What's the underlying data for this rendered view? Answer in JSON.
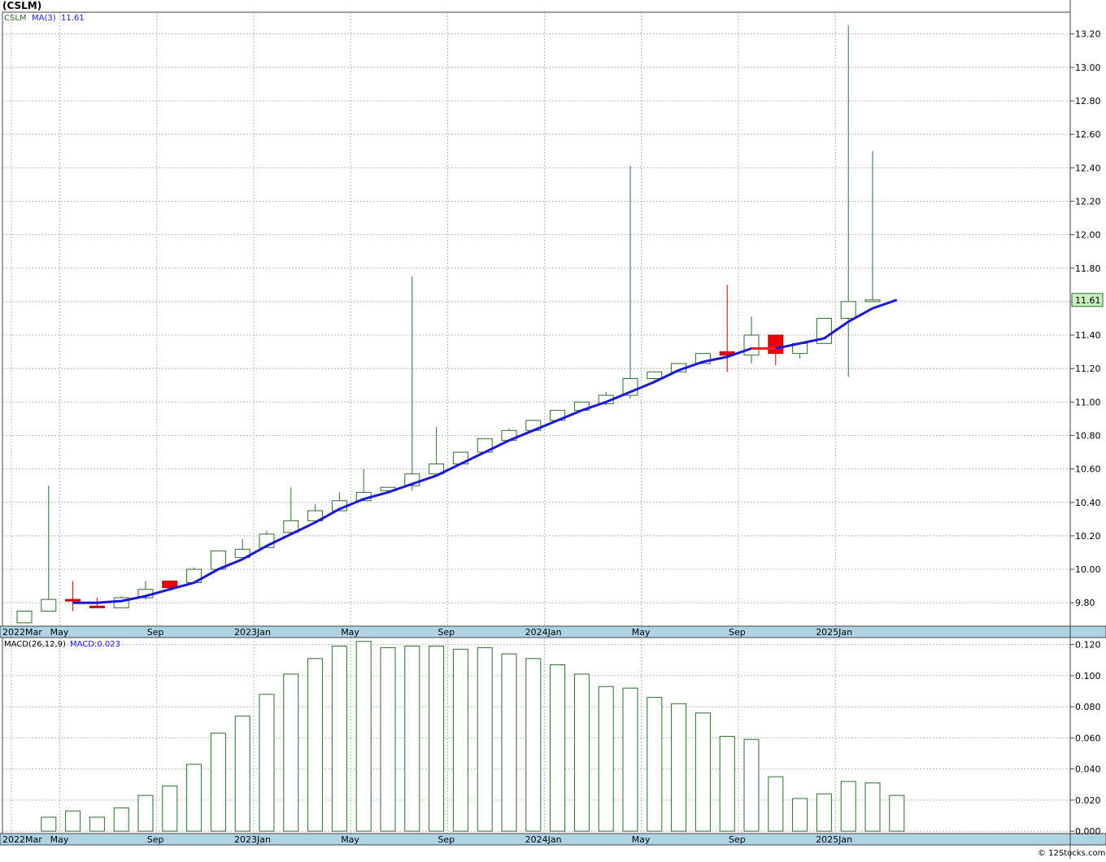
{
  "header": {
    "title": "(CSLM)"
  },
  "colors": {
    "grid": "#b8b8b8",
    "up_stroke": "#2e6b2e",
    "down_fill": "#ee0000",
    "ma_line": "#1818d8",
    "ma_flat": "#ee2222",
    "axis_band": "#aed3e3",
    "macd_bar": "#2e6b2e",
    "last_badge": "#c8f0c0"
  },
  "chart_data": [
    {
      "type": "candlestick",
      "title": "",
      "legend": {
        "symbol": "CSLM",
        "indicator": "MA(3)",
        "indicator_value": "11.61"
      },
      "last_price_label": "11.61",
      "x_tick_labels": [
        "2022Mar",
        "May",
        "Sep",
        "2023Jan",
        "May",
        "Sep",
        "2024Jan",
        "May",
        "Sep",
        "2025Jan"
      ],
      "x_tick_months": [
        0,
        2,
        6,
        10,
        14,
        18,
        22,
        26,
        30,
        34
      ],
      "y_tick_labels": [
        "9.80",
        "10.00",
        "10.20",
        "10.40",
        "10.60",
        "10.80",
        "11.00",
        "11.20",
        "11.40",
        "11.60",
        "11.80",
        "12.00",
        "12.20",
        "12.40",
        "12.60",
        "12.80",
        "13.00",
        "13.20"
      ],
      "ylim": [
        9.66,
        13.33
      ],
      "candles": [
        {
          "m": 0,
          "o": 9.68,
          "h": 9.75,
          "l": 9.68,
          "c": 9.75
        },
        {
          "m": 1,
          "o": 9.75,
          "h": 10.5,
          "l": 9.75,
          "c": 9.82
        },
        {
          "m": 2,
          "o": 9.82,
          "h": 9.93,
          "l": 9.75,
          "c": 9.81
        },
        {
          "m": 3,
          "o": 9.78,
          "h": 9.83,
          "l": 9.77,
          "c": 9.77
        },
        {
          "m": 4,
          "o": 9.77,
          "h": 9.84,
          "l": 9.77,
          "c": 9.83
        },
        {
          "m": 5,
          "o": 9.83,
          "h": 9.93,
          "l": 9.82,
          "c": 9.88
        },
        {
          "m": 6,
          "o": 9.93,
          "h": 9.93,
          "l": 9.89,
          "c": 9.89
        },
        {
          "m": 7,
          "o": 9.92,
          "h": 10.01,
          "l": 9.92,
          "c": 10.0
        },
        {
          "m": 8,
          "o": 10.0,
          "h": 10.11,
          "l": 10.0,
          "c": 10.11
        },
        {
          "m": 9,
          "o": 10.07,
          "h": 10.18,
          "l": 10.07,
          "c": 10.12
        },
        {
          "m": 10,
          "o": 10.13,
          "h": 10.23,
          "l": 10.13,
          "c": 10.21
        },
        {
          "m": 11,
          "o": 10.22,
          "h": 10.49,
          "l": 10.22,
          "c": 10.29
        },
        {
          "m": 12,
          "o": 10.29,
          "h": 10.39,
          "l": 10.29,
          "c": 10.35
        },
        {
          "m": 13,
          "o": 10.35,
          "h": 10.46,
          "l": 10.35,
          "c": 10.41
        },
        {
          "m": 14,
          "o": 10.41,
          "h": 10.6,
          "l": 10.41,
          "c": 10.46
        },
        {
          "m": 15,
          "o": 10.47,
          "h": 10.49,
          "l": 10.47,
          "c": 10.49
        },
        {
          "m": 16,
          "o": 10.5,
          "h": 11.75,
          "l": 10.47,
          "c": 10.57
        },
        {
          "m": 17,
          "o": 10.57,
          "h": 10.85,
          "l": 10.57,
          "c": 10.63
        },
        {
          "m": 18,
          "o": 10.63,
          "h": 10.7,
          "l": 10.63,
          "c": 10.7
        },
        {
          "m": 19,
          "o": 10.7,
          "h": 10.78,
          "l": 10.7,
          "c": 10.78
        },
        {
          "m": 20,
          "o": 10.77,
          "h": 10.84,
          "l": 10.77,
          "c": 10.83
        },
        {
          "m": 21,
          "o": 10.83,
          "h": 10.89,
          "l": 10.83,
          "c": 10.89
        },
        {
          "m": 22,
          "o": 10.89,
          "h": 10.95,
          "l": 10.89,
          "c": 10.95
        },
        {
          "m": 23,
          "o": 10.95,
          "h": 11.0,
          "l": 10.95,
          "c": 11.0
        },
        {
          "m": 24,
          "o": 10.99,
          "h": 11.06,
          "l": 10.98,
          "c": 11.04
        },
        {
          "m": 25,
          "o": 11.04,
          "h": 12.41,
          "l": 11.02,
          "c": 11.14
        },
        {
          "m": 26,
          "o": 11.14,
          "h": 11.18,
          "l": 11.13,
          "c": 11.18
        },
        {
          "m": 27,
          "o": 11.18,
          "h": 11.23,
          "l": 11.18,
          "c": 11.23
        },
        {
          "m": 28,
          "o": 11.23,
          "h": 11.29,
          "l": 11.23,
          "c": 11.29
        },
        {
          "m": 29,
          "o": 11.3,
          "h": 11.7,
          "l": 11.18,
          "c": 11.28
        },
        {
          "m": 30,
          "o": 11.28,
          "h": 11.51,
          "l": 11.23,
          "c": 11.4
        },
        {
          "m": 31,
          "o": 11.4,
          "h": 11.4,
          "l": 11.22,
          "c": 11.29
        },
        {
          "m": 32,
          "o": 11.29,
          "h": 11.35,
          "l": 11.26,
          "c": 11.35
        },
        {
          "m": 33,
          "o": 11.35,
          "h": 11.5,
          "l": 11.35,
          "c": 11.5
        },
        {
          "m": 34,
          "o": 11.5,
          "h": 13.25,
          "l": 11.15,
          "c": 11.6
        },
        {
          "m": 35,
          "o": 11.6,
          "h": 12.5,
          "l": 11.6,
          "c": 11.61
        }
      ],
      "ma_series": [
        {
          "m": 2,
          "v": 9.8
        },
        {
          "m": 3,
          "v": 9.8
        },
        {
          "m": 4,
          "v": 9.81
        },
        {
          "m": 5,
          "v": 9.84
        },
        {
          "m": 6,
          "v": 9.88
        },
        {
          "m": 7,
          "v": 9.92
        },
        {
          "m": 8,
          "v": 10.0
        },
        {
          "m": 9,
          "v": 10.06
        },
        {
          "m": 10,
          "v": 10.14
        },
        {
          "m": 11,
          "v": 10.21
        },
        {
          "m": 12,
          "v": 10.28
        },
        {
          "m": 13,
          "v": 10.36
        },
        {
          "m": 14,
          "v": 10.42
        },
        {
          "m": 15,
          "v": 10.46
        },
        {
          "m": 16,
          "v": 10.51
        },
        {
          "m": 17,
          "v": 10.56
        },
        {
          "m": 18,
          "v": 10.63
        },
        {
          "m": 19,
          "v": 10.7
        },
        {
          "m": 20,
          "v": 10.77
        },
        {
          "m": 21,
          "v": 10.83
        },
        {
          "m": 22,
          "v": 10.89
        },
        {
          "m": 23,
          "v": 10.95
        },
        {
          "m": 24,
          "v": 11.0
        },
        {
          "m": 25,
          "v": 11.06
        },
        {
          "m": 26,
          "v": 11.12
        },
        {
          "m": 27,
          "v": 11.19
        },
        {
          "m": 28,
          "v": 11.24
        },
        {
          "m": 29,
          "v": 11.27
        },
        {
          "m": 30,
          "v": 11.32
        },
        {
          "m": 31,
          "v": 11.32
        },
        {
          "m": 32,
          "v": 11.35
        },
        {
          "m": 33,
          "v": 11.38
        },
        {
          "m": 34,
          "v": 11.48
        },
        {
          "m": 35,
          "v": 11.56
        },
        {
          "m": 36,
          "v": 11.61
        }
      ],
      "ma_flat_segment": [
        30,
        31
      ]
    },
    {
      "type": "bar",
      "title": "",
      "legend": {
        "indicator": "MACD(26,12,9)",
        "indicator_value": "MACD:0.023"
      },
      "y_tick_labels": [
        "0.000",
        "0.020",
        "0.040",
        "0.060",
        "0.080",
        "0.100",
        "0.120"
      ],
      "ylim": [
        -0.0015,
        0.1245
      ],
      "bars": [
        {
          "m": 1,
          "v": 0.009
        },
        {
          "m": 2,
          "v": 0.013
        },
        {
          "m": 3,
          "v": 0.009
        },
        {
          "m": 4,
          "v": 0.015
        },
        {
          "m": 5,
          "v": 0.023
        },
        {
          "m": 6,
          "v": 0.029
        },
        {
          "m": 7,
          "v": 0.043
        },
        {
          "m": 8,
          "v": 0.063
        },
        {
          "m": 9,
          "v": 0.074
        },
        {
          "m": 10,
          "v": 0.088
        },
        {
          "m": 11,
          "v": 0.101
        },
        {
          "m": 12,
          "v": 0.111
        },
        {
          "m": 13,
          "v": 0.119
        },
        {
          "m": 14,
          "v": 0.122
        },
        {
          "m": 15,
          "v": 0.118
        },
        {
          "m": 16,
          "v": 0.119
        },
        {
          "m": 17,
          "v": 0.119
        },
        {
          "m": 18,
          "v": 0.117
        },
        {
          "m": 19,
          "v": 0.118
        },
        {
          "m": 20,
          "v": 0.114
        },
        {
          "m": 21,
          "v": 0.111
        },
        {
          "m": 22,
          "v": 0.107
        },
        {
          "m": 23,
          "v": 0.101
        },
        {
          "m": 24,
          "v": 0.093
        },
        {
          "m": 25,
          "v": 0.092
        },
        {
          "m": 26,
          "v": 0.086
        },
        {
          "m": 27,
          "v": 0.082
        },
        {
          "m": 28,
          "v": 0.076
        },
        {
          "m": 29,
          "v": 0.061
        },
        {
          "m": 30,
          "v": 0.059
        },
        {
          "m": 31,
          "v": 0.035
        },
        {
          "m": 32,
          "v": 0.021
        },
        {
          "m": 33,
          "v": 0.024
        },
        {
          "m": 34,
          "v": 0.032
        },
        {
          "m": 35,
          "v": 0.031
        },
        {
          "m": 36,
          "v": 0.023
        }
      ]
    }
  ],
  "footer": {
    "credit": "© 12Stocks.com"
  }
}
